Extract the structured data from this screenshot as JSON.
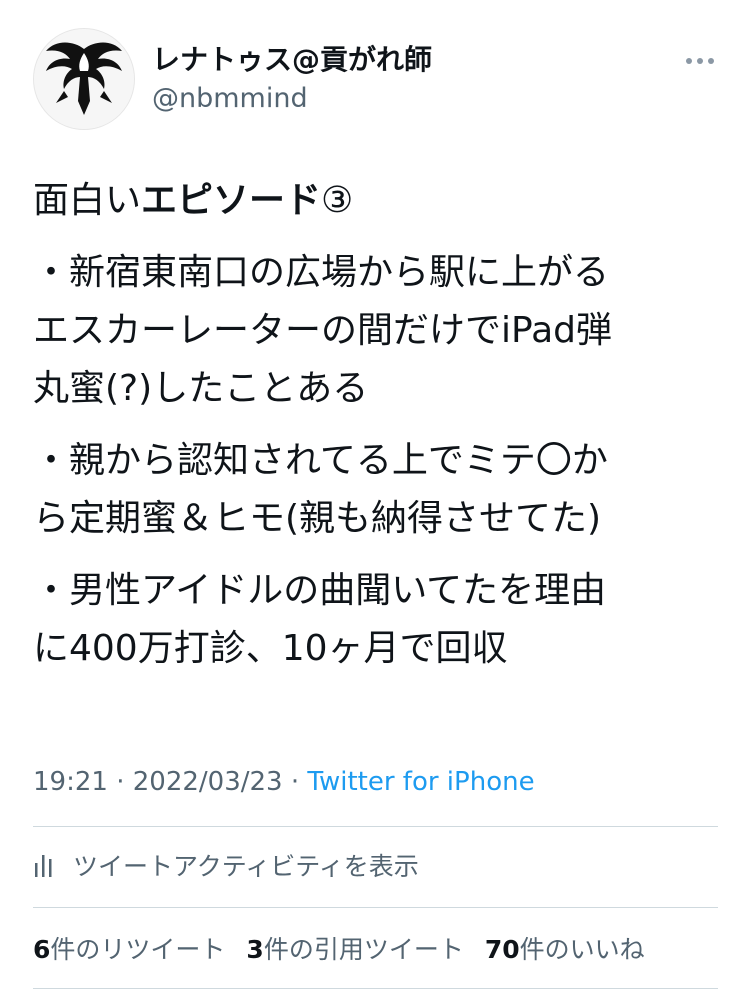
{
  "user": {
    "display_name": "レナトゥス@貢がれ師",
    "handle": "@nbmmind"
  },
  "tweet": {
    "title_normal": "面白い",
    "title_bold": "エピソード",
    "title_suffix": "③",
    "para1_line1": "・新宿東南口の広場から駅に上がる",
    "para1_line2": "エスカーレーターの間だけでiPad弾",
    "para1_line3": "丸蜜(?)したことある",
    "para2_line1": "・親から認知されてる上でミテ〇か",
    "para2_line2": "ら定期蜜＆ヒモ(親も納得させてた)",
    "para3_line1": "・男性アイドルの曲聞いてたを理由",
    "para3_line2": "に400万打診、10ヶ月で回収"
  },
  "meta": {
    "time": "19:21",
    "separator1": " · ",
    "date": "2022/03/23",
    "separator2": " · ",
    "source": "Twitter for iPhone"
  },
  "activity": {
    "icon": "bar-chart-icon",
    "label": "ツイートアクティビティを表示"
  },
  "stats": {
    "retweets_count": "6",
    "retweets_label": "件のリツイート",
    "quotes_count": "3",
    "quotes_label": "件の引用ツイート",
    "likes_count": "70",
    "likes_label": "件のいいね"
  },
  "colors": {
    "text": "#0f1419",
    "secondary": "#536471",
    "link": "#1d9bf0",
    "divider": "#cfd9de"
  }
}
